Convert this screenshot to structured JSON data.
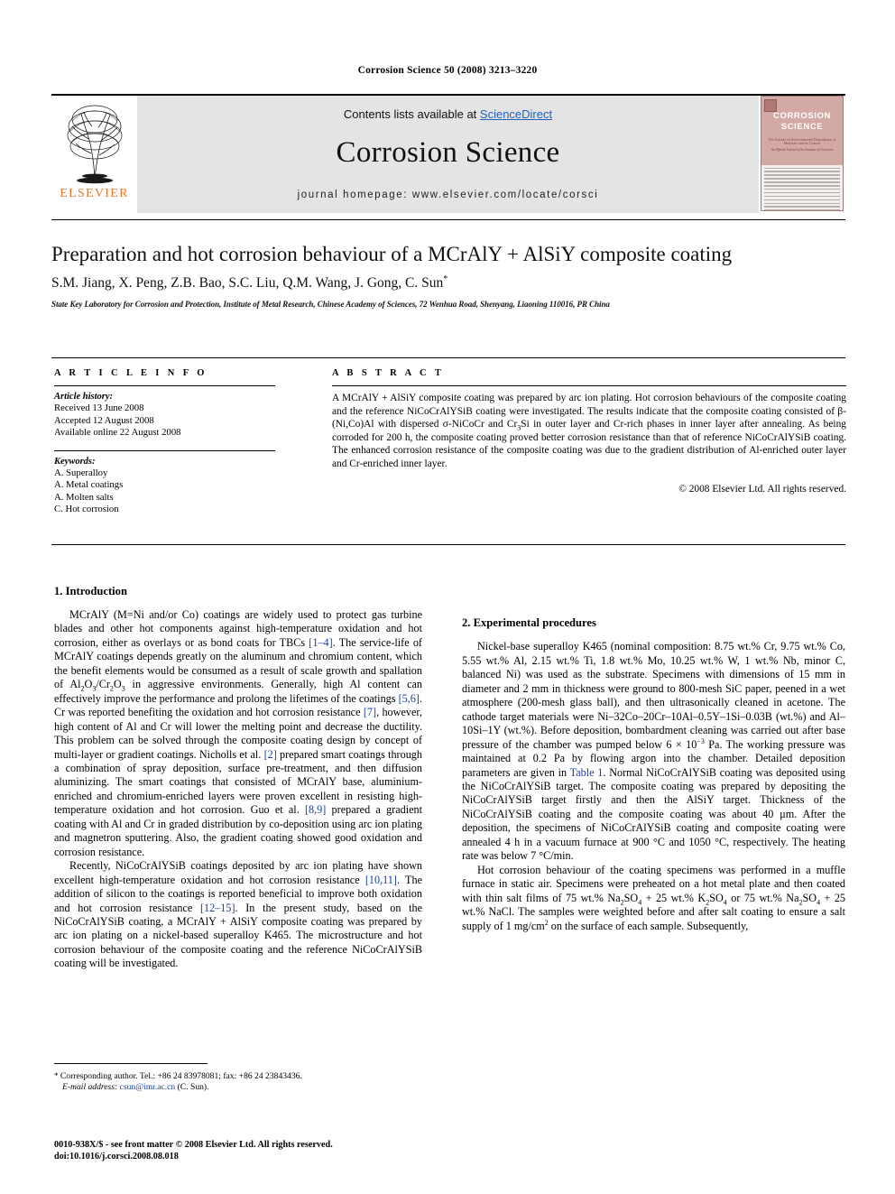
{
  "running_head": "Corrosion Science 50 (2008) 3213–3220",
  "masthead": {
    "publisher_name": "ELSEVIER",
    "contents_prefix": "Contents lists available at ",
    "contents_link": "ScienceDirect",
    "journal_title": "Corrosion Science",
    "homepage": "journal homepage: www.elsevier.com/locate/corsci",
    "cover": {
      "title_line1": "CORROSION",
      "title_line2": "SCIENCE",
      "subtitle": "The Journal on Environmental Degradation of Materials and its Control",
      "subtitle2": "An Official Journal of the Institute of Corrosion"
    }
  },
  "article": {
    "title": "Preparation and hot corrosion behaviour of a MCrAlY + AlSiY composite coating",
    "authors": "S.M. Jiang, X. Peng, Z.B. Bao, S.C. Liu, Q.M. Wang, J. Gong, C. Sun",
    "author_marker": "*",
    "affiliation": "State Key Laboratory for Corrosion and Protection, Institute of Metal Research, Chinese Academy of Sciences, 72 Wenhua Road, Shenyang, Liaoning 110016, PR China"
  },
  "article_info": {
    "heading": "A R T I C L E   I N F O",
    "history_label": "Article history:",
    "history": [
      "Received 13 June 2008",
      "Accepted 12 August 2008",
      "Available online 22 August 2008"
    ],
    "keywords_label": "Keywords:",
    "keywords": [
      "A. Superalloy",
      "A. Metal coatings",
      "A. Molten salts",
      "C. Hot corrosion"
    ]
  },
  "abstract": {
    "heading": "A B S T R A C T",
    "text_part1": "A MCrAlY + AlSiY composite coating was prepared by arc ion plating. Hot corrosion behaviours of the composite coating and the reference NiCoCrAlYSiB coating were investigated. The results indicate that the composite coating consisted of β-(Ni,Co)Al with dispersed σ-NiCoCr and Cr",
    "sub_3": "3",
    "text_part2": "Si in outer layer and Cr-rich phases in inner layer after annealing. As being corroded for 200 h, the composite coating proved better corrosion resistance than that of reference NiCoCrAlYSiB coating. The enhanced corrosion resistance of the composite coating was due to the gradient distribution of Al-enriched outer layer and Cr-enriched inner layer.",
    "copyright": "© 2008 Elsevier Ltd. All rights reserved."
  },
  "sections": {
    "intro_heading": "1. Introduction",
    "experimental_heading": "2. Experimental procedures"
  },
  "intro": {
    "p1_a": "MCrAlY (M=Ni and/or Co) coatings are widely used to protect gas turbine blades and other hot components against high-temperature oxidation and hot corrosion, either as overlays or as bond coats for TBCs ",
    "p1_ref1": "[1–4]",
    "p1_b": ". The service-life of MCrAlY coatings depends greatly on the aluminum and chromium content, which the benefit elements would be consumed as a result of scale growth and spallation of Al",
    "p1_sub1": "2",
    "p1_c": "O",
    "p1_sub2": "3",
    "p1_d": "/Cr",
    "p1_sub3": "2",
    "p1_e": "O",
    "p1_sub4": "3",
    "p1_f": " in aggressive environments. Generally, high Al content can effectively improve the performance and prolong the lifetimes of the coatings ",
    "p1_ref2": "[5,6]",
    "p1_g": ". Cr was reported benefiting the oxidation and hot corrosion resistance ",
    "p1_ref3": "[7]",
    "p1_h": ", however, high content of Al and Cr will lower the melting point and decrease the ductility. This problem can be solved through the composite coating design by concept of multi-layer or gradient coatings. Nicholls et al. ",
    "p1_ref4": "[2]",
    "p1_i": " prepared smart coatings through a combination of spray deposition, surface pre-treatment, and then diffusion aluminizing. The smart coatings that consisted of MCrAlY base, aluminium-enriched and chromium-enriched layers were proven excellent in resisting high-temperature oxidation and hot corrosion. Guo et al. ",
    "p1_ref5": "[8,9]",
    "p1_j": " prepared a gradient coating with Al and Cr in graded distribution by co-deposition using arc ion plating and magnetron sputtering. Also, the gradient coating showed good oxidation and corrosion resistance.",
    "p2_a": "Recently, NiCoCrAlYSiB coatings deposited by arc ion plating have shown excellent high-temperature oxidation and hot corrosion resistance ",
    "p2_ref1": "[10,11]",
    "p2_b": ". The addition of silicon to the coatings is reported beneficial to improve both oxidation and hot corrosion resistance ",
    "p2_ref2": "[12–15]",
    "p2_c": ". In the present study, based on the NiCoCrAlYSiB coating, a MCrAlY + AlSiY composite coating was prepared by arc ion plating on a nickel-based superalloy K465. The microstructure and hot corrosion behaviour of the composite coating and the reference NiCoCrAlYSiB coating will be investigated."
  },
  "experimental": {
    "p1_a": "Nickel-base superalloy K465 (nominal composition: 8.75 wt.% Cr, 9.75 wt.% Co, 5.55 wt.% Al, 2.15 wt.% Ti, 1.8 wt.% Mo, 10.25 wt.% W, 1 wt.% Nb, minor C, balanced Ni) was used as the substrate. Specimens with dimensions of 15 mm in diameter and 2 mm in thickness were ground to 800-mesh SiC paper, peened in a wet atmosphere (200-mesh glass ball), and then ultrasonically cleaned in acetone. The cathode target materials were Ni–32Co–20Cr–10Al–0.5Y–1Si–0.03B (wt.%) and Al–10Si–1Y (wt.%). Before deposition, bombardment cleaning was carried out after base pressure of the chamber was pumped below 6 × 10",
    "p1_sup": "−3",
    "p1_b": " Pa. The working pressure was maintained at 0.2 Pa by flowing argon into the chamber. Detailed deposition parameters are given in ",
    "p1_ref1": "Table 1",
    "p1_c": ". Normal NiCoCrAlYSiB coating was deposited using the NiCoCrAlYSiB target. The composite coating was prepared by depositing the NiCoCrAlYSiB target firstly and then the AlSiY target. Thickness of the NiCoCrAlYSiB coating and the composite coating was about 40 μm. After the deposition, the specimens of NiCoCrAlYSiB coating and composite coating were annealed 4 h in a vacuum furnace at 900 °C and 1050 °C, respectively. The heating rate was below 7 °C/min.",
    "p2_a": "Hot corrosion behaviour of the coating specimens was performed in a muffle furnace in static air. Specimens were preheated on a hot metal plate and then coated with thin salt films of 75 wt.% Na",
    "p2_sub1": "2",
    "p2_b": "SO",
    "p2_sub2": "4",
    "p2_c": " + 25 wt.% K",
    "p2_sub3": "2",
    "p2_d": "SO",
    "p2_sub4": "4",
    "p2_e": " or 75 wt.% Na",
    "p2_sub5": "2",
    "p2_f": "SO",
    "p2_sub6": "4",
    "p2_g": " + 25 wt.% NaCl. The samples were weighted before and after salt coating to ensure a salt supply of 1 mg/cm",
    "p2_sup1": "2",
    "p2_h": " on the surface of each sample. Subsequently,"
  },
  "footnote": {
    "marker": "*",
    "corresponding": "Corresponding author. Tel.: +86 24 83978081; fax: +86 24 23843436.",
    "email_label": "E-mail address:",
    "email": "csun@imr.ac.cn",
    "email_suffix": "(C. Sun)."
  },
  "imprint": {
    "line1": "0010-938X/$ - see front matter © 2008 Elsevier Ltd. All rights reserved.",
    "line2": "doi:10.1016/j.corsci.2008.08.018"
  },
  "colors": {
    "link": "#2060c0",
    "reference": "#1a3ea8",
    "elsevier_orange": "#E87722",
    "masthead_gray": "#e4e4e4"
  }
}
